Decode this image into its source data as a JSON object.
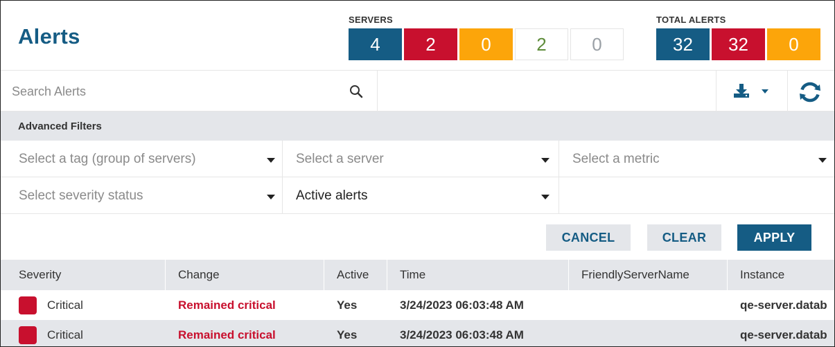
{
  "page": {
    "title": "Alerts"
  },
  "servers": {
    "label": "SERVERS",
    "counts": [
      {
        "value": "4",
        "color": "#155c84"
      },
      {
        "value": "2",
        "color": "#c8102e"
      },
      {
        "value": "0",
        "color": "#fca50a"
      },
      {
        "value": "2",
        "color": "#5e8c3a"
      },
      {
        "value": "0",
        "color": "#9aa0a6"
      }
    ]
  },
  "total_alerts": {
    "label": "TOTAL ALERTS",
    "counts": [
      {
        "value": "32",
        "color": "#155c84"
      },
      {
        "value": "32",
        "color": "#c8102e"
      },
      {
        "value": "0",
        "color": "#fca50a"
      }
    ]
  },
  "search": {
    "placeholder": "Search Alerts",
    "icon": "search-icon"
  },
  "toolbar": {
    "download_icon": "download-icon",
    "refresh_icon": "refresh-icon"
  },
  "advanced_filters": {
    "label": "Advanced Filters",
    "tag": "Select a tag (group of servers)",
    "server": "Select a server",
    "metric": "Select a metric",
    "severity": "Select severity status",
    "active": "Active alerts"
  },
  "buttons": {
    "cancel": "CANCEL",
    "clear": "CLEAR",
    "apply": "APPLY"
  },
  "table": {
    "columns": [
      "Severity",
      "Change",
      "Active",
      "Time",
      "FriendlyServerName",
      "Instance"
    ],
    "rows": [
      {
        "severity": "Critical",
        "change": "Remained critical",
        "active": "Yes",
        "time": "3/24/2023 06:03:48 AM",
        "friendly": "",
        "instance": "qe-server.datab"
      },
      {
        "severity": "Critical",
        "change": "Remained critical",
        "active": "Yes",
        "time": "3/24/2023 06:03:48 AM",
        "friendly": "",
        "instance": "qe-server.datab"
      }
    ]
  },
  "colors": {
    "accent": "#155c84",
    "critical": "#c8102e",
    "warning": "#fca50a",
    "ok": "#5e8c3a"
  }
}
